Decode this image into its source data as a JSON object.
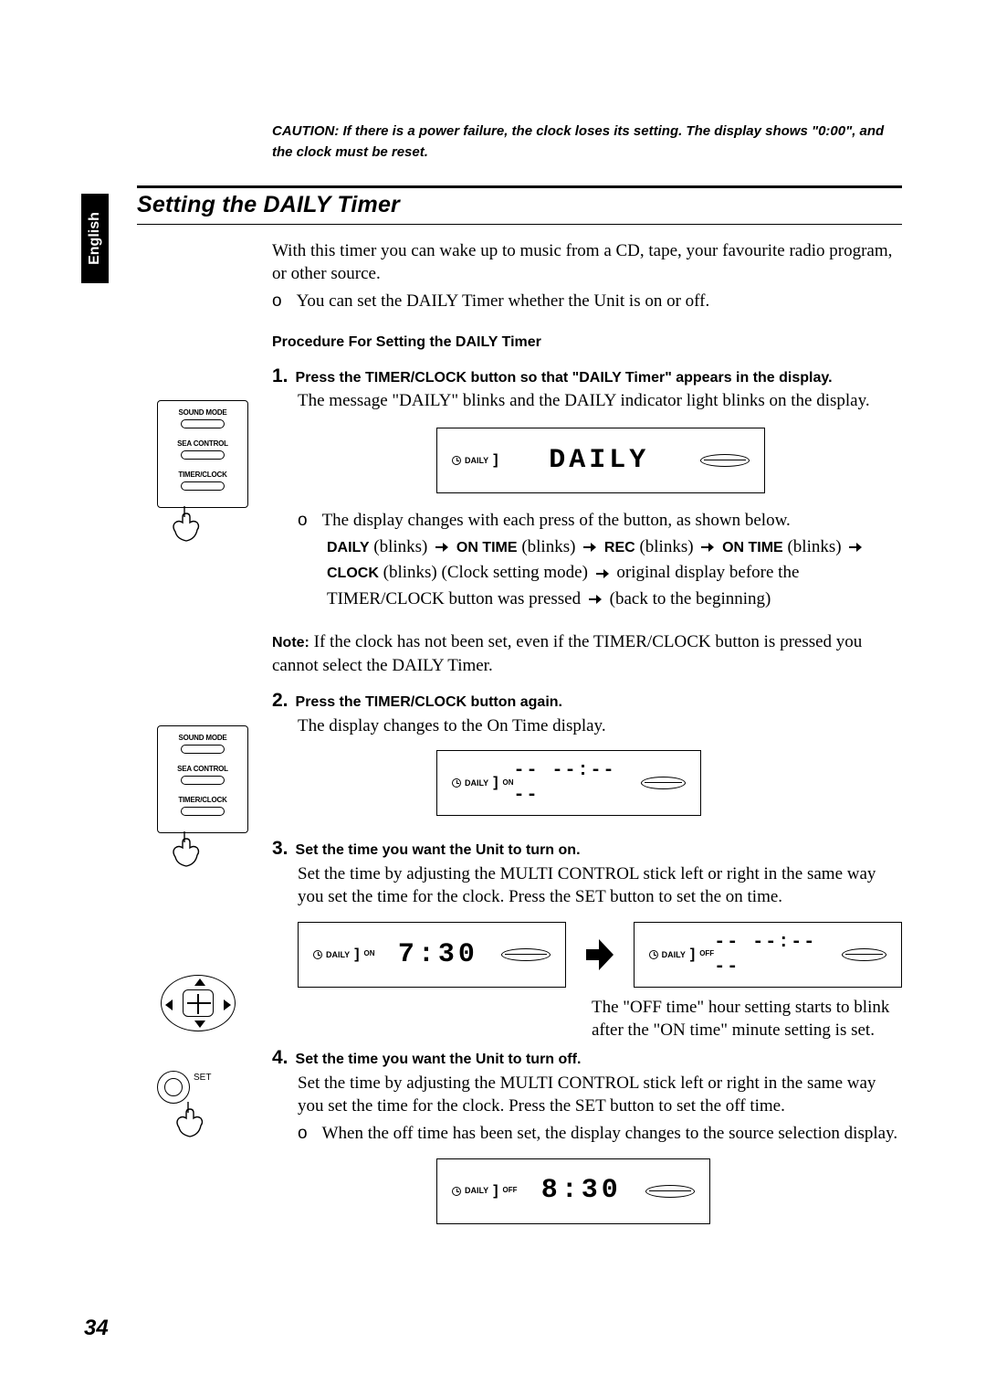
{
  "language_tab": "English",
  "caution": "CAUTION: If there is a power failure, the clock loses its setting. The display shows \"0:00\", and the clock must be reset.",
  "section_title": "Setting the DAILY Timer",
  "intro": "With this timer you can wake up to music from a CD, tape, your favourite radio program, or other source.",
  "intro_bullet_marker": "o",
  "intro_bullet": "You can set the DAILY Timer whether the Unit is on or off.",
  "procedure_heading": "Procedure For Setting the DAILY Timer",
  "step1": {
    "num": "1.",
    "title": "Press the TIMER/CLOCK button so that \"DAILY Timer\" appears in the display.",
    "body": "The message \"DAILY\" blinks and the DAILY indicator light blinks on the display.",
    "display_label": "DAILY",
    "display_text": "DAILY",
    "flow_intro_marker": "o",
    "flow_intro": "The display changes with each press of the button, as shown below.",
    "flow_seq": {
      "s1": "DAILY",
      "b1": " (blinks) ",
      "s2": "ON TIME",
      "b2": " (blinks) ",
      "s3": "REC",
      "b3": " (blinks) ",
      "s4": "ON TIME",
      "b4": " (blinks) ",
      "s5": "CLOCK",
      "b5": " (blinks) (Clock setting mode) ",
      "tail1": " original display before the TIMER/CLOCK button was pressed ",
      "tail2": " (back to the beginning)"
    }
  },
  "note_label": "Note:",
  "note_body": " If the clock has not been set, even if the TIMER/CLOCK button is pressed you cannot select the DAILY Timer.",
  "step2": {
    "num": "2.",
    "title": "Press the TIMER/CLOCK button again.",
    "body": "The display changes to the On Time display.",
    "display_label": "DAILY",
    "display_sub": "ON",
    "display_text": "-- --:-- --"
  },
  "step3": {
    "num": "3.",
    "title": "Set the time you want the Unit to turn on.",
    "body": "Set the time by adjusting the MULTI CONTROL stick left or right in the same way you set the time for the clock. Press the SET button to set the on time.",
    "display_left_label": "DAILY",
    "display_left_sub": "ON",
    "display_left_text": "7:30",
    "display_right_label": "DAILY",
    "display_right_sub": "OFF",
    "display_right_text": "-- --:-- --",
    "side_text1": "The \"OFF time\" hour setting starts to blink",
    "side_text2": "after the \"ON time\" minute setting is set."
  },
  "step4": {
    "num": "4.",
    "title": "Set the time you want the Unit to turn off.",
    "body": "Set the time by adjusting the MULTI CONTROL stick left or right in the same way you set the time for the clock. Press the SET button to set the off time.",
    "bullet_marker": "o",
    "bullet": "When the off time has been set, the display changes to the source selection display.",
    "display_label": "DAILY",
    "display_sub": "OFF",
    "display_text": "8:30"
  },
  "remote_labels": {
    "sound_mode": "SOUND MODE",
    "sea_control": "SEA CONTROL",
    "timer_clock": "TIMER/CLOCK"
  },
  "set_label": "SET",
  "page_number": "34"
}
